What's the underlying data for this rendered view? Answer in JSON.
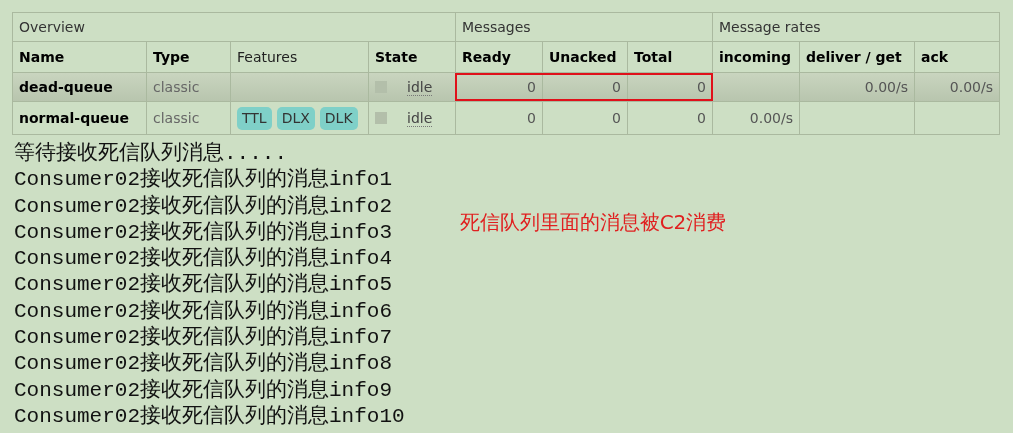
{
  "table": {
    "groups": [
      {
        "label": "Overview",
        "columns": [
          "Name",
          "Type",
          "Features",
          "State"
        ]
      },
      {
        "label": "Messages",
        "columns": [
          "Ready",
          "Unacked",
          "Total"
        ]
      },
      {
        "label": "Message rates",
        "columns": [
          "incoming",
          "deliver / get",
          "ack"
        ]
      }
    ],
    "rows": [
      {
        "name": "dead-queue",
        "type": "classic",
        "features": [],
        "state": "idle",
        "ready": "0",
        "unacked": "0",
        "total": "0",
        "deliver_get": "0.00/s",
        "ack": "0.00/s",
        "highlighted": true,
        "framed": true
      },
      {
        "name": "normal-queue",
        "type": "classic",
        "features": [
          "TTL",
          "DLX",
          "DLK"
        ],
        "state": "idle",
        "ready": "0",
        "unacked": "0",
        "total": "0",
        "incoming": "0.00/s",
        "highlighted": false,
        "framed": false
      }
    ]
  },
  "console": {
    "lines": [
      "等待接收死信队列消息.....",
      "Consumer02接收死信队列的消息info1",
      "Consumer02接收死信队列的消息info2",
      "Consumer02接收死信队列的消息info3",
      "Consumer02接收死信队列的消息info4",
      "Consumer02接收死信队列的消息info5",
      "Consumer02接收死信队列的消息info6",
      "Consumer02接收死信队列的消息info7",
      "Consumer02接收死信队列的消息info8",
      "Consumer02接收死信队列的消息info9",
      "Consumer02接收死信队列的消息info10"
    ]
  },
  "annotation": {
    "text": "死信队列里面的消息被C2消费"
  }
}
